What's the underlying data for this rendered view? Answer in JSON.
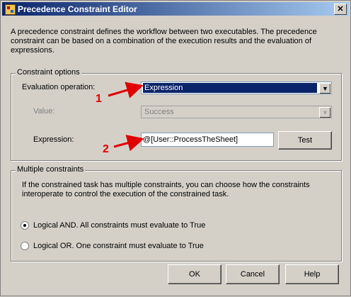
{
  "window": {
    "title": "Precedence Constraint Editor",
    "close_glyph": "✕"
  },
  "description": "A precedence constraint defines the workflow between two executables. The precedence constraint can be based on a combination of the execution results and the evaluation of expressions.",
  "constraint_options": {
    "legend": "Constraint options",
    "evaluation_label": "Evaluation operation:",
    "evaluation_value": "Expression",
    "value_label": "Value:",
    "value_value": "Success",
    "expression_label": "Expression:",
    "expression_value": "@[User::ProcessTheSheet]",
    "test_label": "Test"
  },
  "multiple_constraints": {
    "legend": "Multiple constraints",
    "description": "If the constrained task has multiple constraints, you can choose how the constraints interoperate to control the execution of the constrained task.",
    "option_and": "Logical AND. All constraints must evaluate to True",
    "option_or": "Logical OR. One constraint must evaluate to True",
    "selected": "and"
  },
  "buttons": {
    "ok": "OK",
    "cancel": "Cancel",
    "help": "Help"
  },
  "annotations": {
    "marker1": "1",
    "marker2": "2",
    "color": "#e00000"
  },
  "icons": {
    "dropdown": "▼"
  }
}
